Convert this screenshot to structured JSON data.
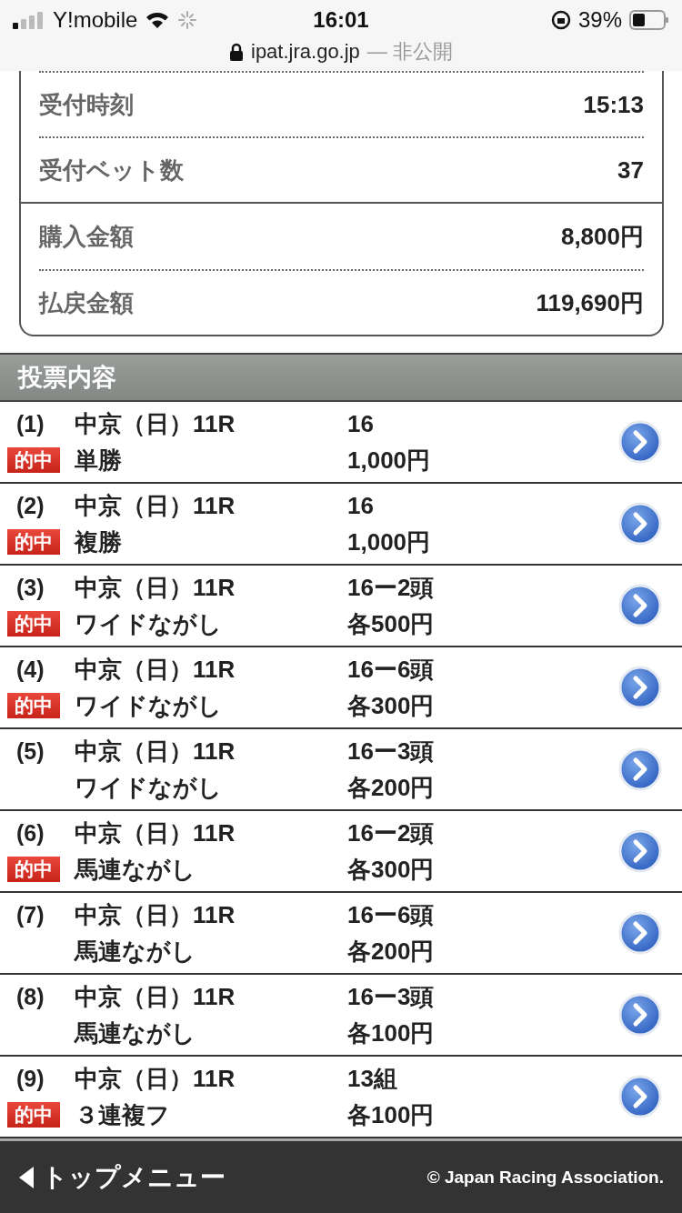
{
  "status_bar": {
    "carrier": "Y!mobile",
    "time": "16:01",
    "battery": "39%",
    "url": "ipat.jra.go.jp",
    "privacy": "— 非公開"
  },
  "summary": {
    "groups": [
      [
        {
          "label": "受付時刻",
          "value": "15:13"
        },
        {
          "label": "受付ベット数",
          "value": "37"
        }
      ],
      [
        {
          "label": "購入金額",
          "value": "8,800円"
        },
        {
          "label": "払戻金額",
          "value": "119,690円"
        }
      ]
    ]
  },
  "section_title": "投票内容",
  "bets": [
    {
      "number": "(1)",
      "race": "中京（日）11R",
      "type": "単勝",
      "selection": "16",
      "amount": "1,000円",
      "hit_label": "的中"
    },
    {
      "number": "(2)",
      "race": "中京（日）11R",
      "type": "複勝",
      "selection": "16",
      "amount": "1,000円",
      "hit_label": "的中"
    },
    {
      "number": "(3)",
      "race": "中京（日）11R",
      "type": "ワイドながし",
      "selection": "16ー2頭",
      "amount": "各500円",
      "hit_label": "的中"
    },
    {
      "number": "(4)",
      "race": "中京（日）11R",
      "type": "ワイドながし",
      "selection": "16ー6頭",
      "amount": "各300円",
      "hit_label": "的中"
    },
    {
      "number": "(5)",
      "race": "中京（日）11R",
      "type": "ワイドながし",
      "selection": "16ー3頭",
      "amount": "各200円"
    },
    {
      "number": "(6)",
      "race": "中京（日）11R",
      "type": "馬連ながし",
      "selection": "16ー2頭",
      "amount": "各300円",
      "hit_label": "的中"
    },
    {
      "number": "(7)",
      "race": "中京（日）11R",
      "type": "馬連ながし",
      "selection": "16ー6頭",
      "amount": "各200円"
    },
    {
      "number": "(8)",
      "race": "中京（日）11R",
      "type": "馬連ながし",
      "selection": "16ー3頭",
      "amount": "各100円"
    },
    {
      "number": "(9)",
      "race": "中京（日）11R",
      "type": "３連複フ",
      "selection": "13組",
      "amount": "各100円",
      "hit_label": "的中"
    }
  ],
  "footer": {
    "back": "トップメニュー",
    "copyright": "© Japan Racing Association."
  }
}
